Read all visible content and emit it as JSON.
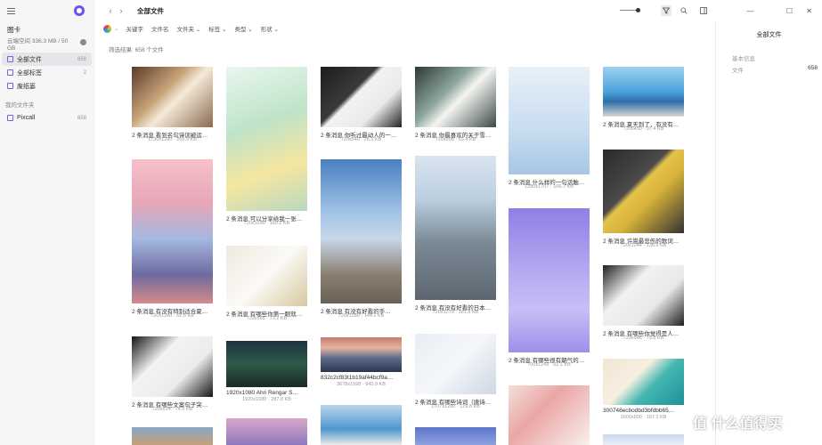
{
  "sidebar": {
    "library_name": "图卡",
    "storage": "云端空间 336.3 MB / 50 GB",
    "nav": [
      {
        "label": "全部文件",
        "count": "658"
      },
      {
        "label": "全部标签",
        "count": "2"
      },
      {
        "label": "废纸篓",
        "count": ""
      }
    ],
    "folders_label": "我的文件夹",
    "folders": [
      {
        "label": "Pixcall",
        "count": "658"
      }
    ]
  },
  "toolbar": {
    "title": "全部文件",
    "filters": [
      "关键字",
      "文件名",
      "文件夹 ⌄",
      "标签 ⌄",
      "类型 ⌄",
      "形状 ⌄"
    ],
    "result": "筛选结果: 658 个文件"
  },
  "panel": {
    "title": "全部文件",
    "section": "基本信息",
    "row_label": "文件",
    "row_value": "658"
  },
  "watermark": "值 什么值得买",
  "cards": [
    {
      "name": "2 条消息 看到名句诗词被运…",
      "meta": "1730x1280 · 260.9 KB"
    },
    {
      "name": "2 条消息 可以分享给我一张…",
      "meta": "720x1280 · 160.2 KB"
    },
    {
      "name": "2 条消息 你听过最动人的一…",
      "meta": "720x540 · 28.1 KB"
    },
    {
      "name": "2 条消息 你最喜欢的关于雪…",
      "meta": "720x508 · 63.4 KB"
    },
    {
      "name": "2 条消息 什么样的一句话触…",
      "meta": "1280x1707 · 166.7 KB"
    },
    {
      "name": "2 条消息 夏天到了，有没有…",
      "meta": "720x450 · 97.4 KB"
    },
    {
      "name": "2 条消息 有没有特别适合夏…",
      "meta": "720x1280 · 62.5 KB"
    },
    {
      "name": "2 条消息 有哪些你第一眼就…",
      "meta": "720x565 · 73.2 KB"
    },
    {
      "name": "2 条消息 有没有好看的手…",
      "meta": "720x1280 · 144.2 KB"
    },
    {
      "name": "2 条消息 有没有好看的日本…",
      "meta": "720x1279 · 181.8 KB"
    },
    {
      "name": "2 条消息 许嵩最悲伤的歌词…",
      "meta": "720x1244 · 136.9 KB"
    },
    {
      "name": "2 条消息 有哪些很有朝气的…",
      "meta": "700x1243 · 52.1 KB"
    },
    {
      "name": "2 条消息 有哪些你觉得是人…",
      "meta": "720x546 · 79.8 KB"
    },
    {
      "name": "2 条消息 有哪些文案句子突…",
      "meta": "720x514 · 74.6 KB"
    },
    {
      "name": "1920x1080 Ahri Rengar S…",
      "meta": "1920x1080 · 287.8 KB"
    },
    {
      "name": "832c2cf83t1b19af44bcf9a…",
      "meta": "3678x1598 · 940.9 KB"
    },
    {
      "name": "2 条消息 有哪些诗词（唐诗…",
      "meta": "1707x1280 · 129.8 KB"
    },
    {
      "name": "300748ecbodbd3bfdbb65…",
      "meta": "1600x900 · 167.2 KB"
    }
  ]
}
